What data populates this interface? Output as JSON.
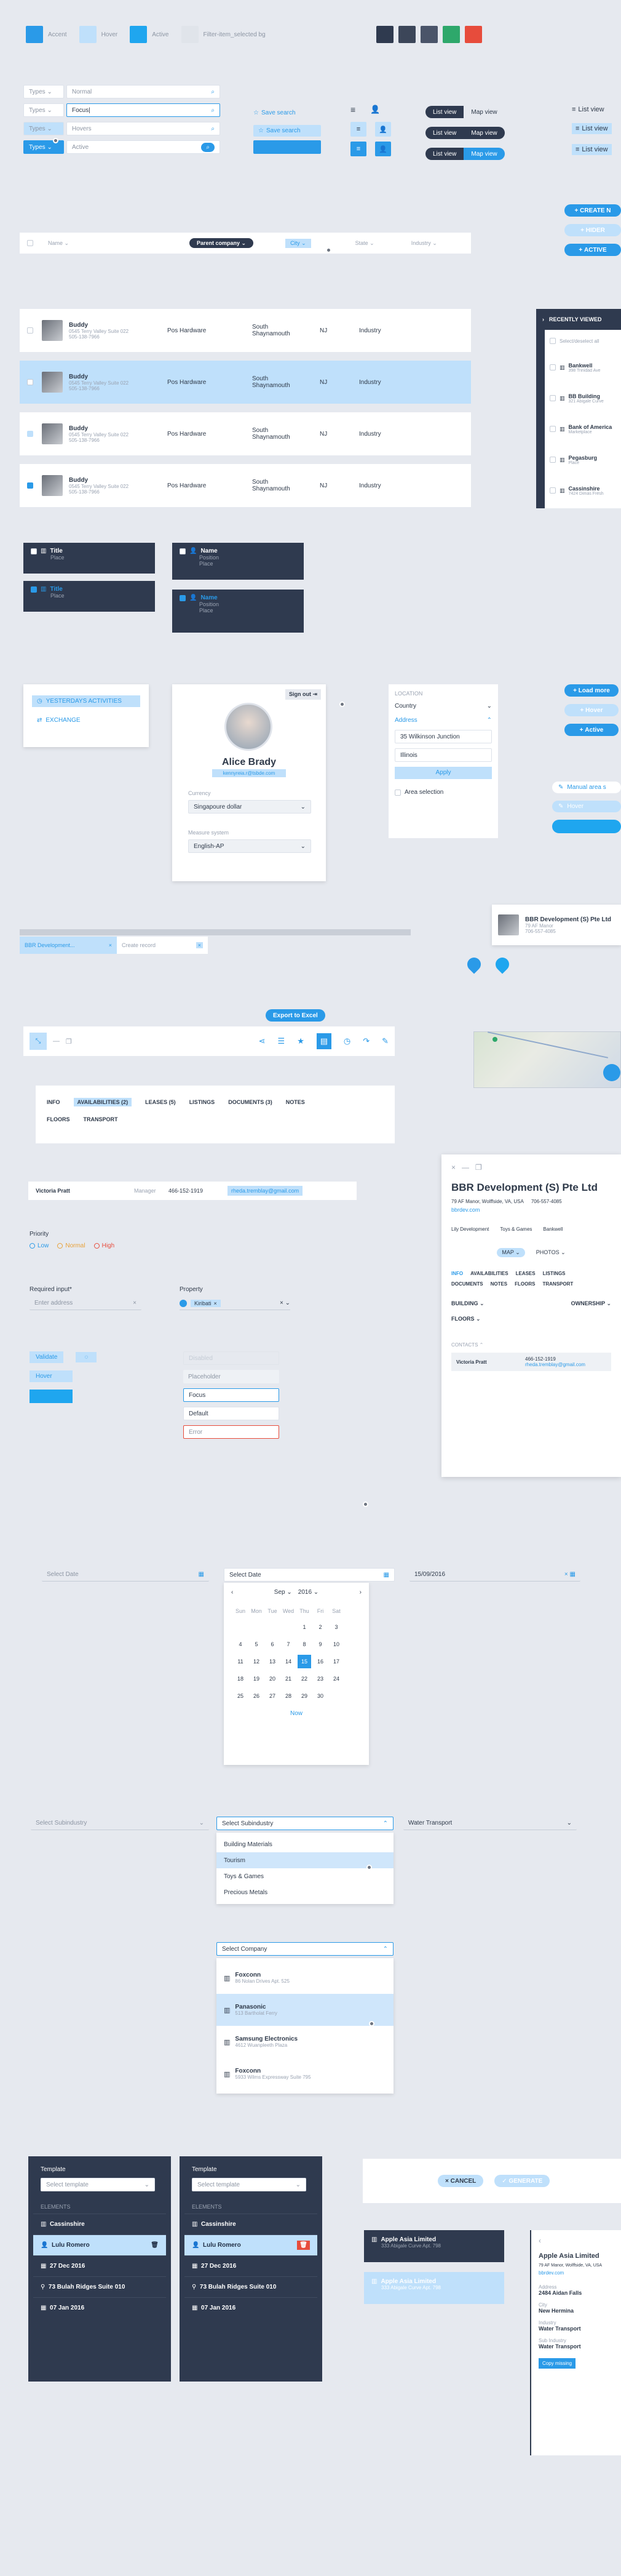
{
  "legend": [
    {
      "label": "Accent",
      "color": "#2a9ae8"
    },
    {
      "label": "Hover",
      "color": "#bfe0fb"
    },
    {
      "label": "Active",
      "color": "#1fa6ef"
    },
    {
      "label": "Filter-item_selected bg",
      "color": "#e0e4ea"
    }
  ],
  "palette": [
    "#2f3a4f",
    "#3c4659",
    "#4a5469",
    "#2ea86b",
    "#e74c3c"
  ],
  "filters": {
    "type_label": "Types",
    "rows": [
      {
        "value": "Normal"
      },
      {
        "value": "Focus|"
      },
      {
        "value": "Hovers"
      },
      {
        "value": "Active"
      }
    ]
  },
  "search": {
    "save_label": "Save search"
  },
  "viewtoggle": {
    "list": "List view",
    "map": "Map view"
  },
  "actions": {
    "create": "CREATE N",
    "hider": "HIDER",
    "active": "ACTIVE"
  },
  "table": {
    "headers": [
      "Name",
      "Parent company",
      "City",
      "State",
      "Industry"
    ],
    "rows": [
      {
        "name": "Buddy",
        "addr": "0545 Terry Valley Suite 022",
        "phone": "505-138-7966",
        "company": "Pos Hardware",
        "city1": "South",
        "city2": "Shaynamouth",
        "state": "NJ",
        "industry": "Industry"
      },
      {
        "name": "Buddy",
        "addr": "0545 Terry Valley Suite 022",
        "phone": "505-138-7966",
        "company": "Pos Hardware",
        "city1": "South",
        "city2": "Shaynamouth",
        "state": "NJ",
        "industry": "Industry"
      },
      {
        "name": "Buddy",
        "addr": "0545 Terry Valley Suite 022",
        "phone": "505-138-7966",
        "company": "Pos Hardware",
        "city1": "South",
        "city2": "Shaynamouth",
        "state": "NJ",
        "industry": "Industry"
      },
      {
        "name": "Buddy",
        "addr": "0545 Terry Valley Suite 022",
        "phone": "505-138-7966",
        "company": "Pos Hardware",
        "city1": "South",
        "city2": "Shaynamouth",
        "state": "NJ",
        "industry": "Industry"
      }
    ]
  },
  "recent": {
    "title": "RECENTLY VIEWED",
    "select_label": "Select/deselect all",
    "items": [
      {
        "name": "Bankwell",
        "sub": "398 Trinidad Ave"
      },
      {
        "name": "BB Building",
        "sub": "321 Abigale Curve"
      },
      {
        "name": "Bank of America",
        "sub": "Marketplace"
      },
      {
        "name": "Pegasburg",
        "sub": "Place"
      },
      {
        "name": "Cassinshire",
        "sub": "7424 Dimas Fresh"
      }
    ]
  },
  "cards": {
    "title": "Title",
    "place": "Place",
    "name": "Name",
    "position": "Position"
  },
  "history": {
    "yesterday": "YESTERDAYS ACTIVITIES",
    "exchange": "EXCHANGE"
  },
  "profile": {
    "signout": "Sign out",
    "name": "Alice Brady",
    "email": "kennyreia.r@tsbde.com",
    "currency_label": "Currency",
    "currency_value": "Singapoure dollar",
    "measure_label": "Measure system",
    "measure_value": "English-AP"
  },
  "location": {
    "title": "LOCATION",
    "country": "Country",
    "address": "Address",
    "address_value": "35 Wilkinson Junction",
    "state_value": "Illinois",
    "apply": "Apply",
    "area": "Area selection"
  },
  "loadmore": {
    "load": "Load more",
    "hover": "Hover",
    "active": "Active"
  },
  "manual": {
    "label": "Manual area s",
    "hover": "Hover"
  },
  "records": {
    "tab1": "BBR Development...",
    "tab2": "Create record"
  },
  "bbr_card": {
    "name": "BBR Development (S) Pte Ltd",
    "addr": "79 AF Manor",
    "phone": "706-557-4085"
  },
  "export": "Export to Excel",
  "tabs": {
    "row1": [
      "INFO",
      "AVAILABILITIES (2)",
      "LEASES (5)",
      "LISTINGS",
      "DOCUMENTS (3)",
      "NOTES"
    ],
    "row2": [
      "FLOORS",
      "TRANSPORT"
    ]
  },
  "contact": {
    "name": "Victoria Pratt",
    "role": "Manager",
    "phone": "466-152-1919",
    "email": "rheda.tremblay@gmail.com"
  },
  "priority": {
    "label": "Priority",
    "low": "Low",
    "normal": "Normal",
    "high": "High"
  },
  "required": {
    "label": "Required input*",
    "placeholder": "Enter address"
  },
  "property": {
    "label": "Property",
    "value": "Kiribati"
  },
  "buttons": {
    "validate": "Validate",
    "hover": "Hover"
  },
  "states": {
    "disabled": "Disabled",
    "placeholder": "Placeholder",
    "focus": "Focus",
    "default": "Default",
    "error": "Error"
  },
  "detail": {
    "name": "BBR Development (S) Pte Ltd",
    "addr": "79 AF Manor, Wolffside, VA, USA",
    "phone": "706-557-4085",
    "site": "bbrdev.com",
    "tags": [
      "Lily Development",
      "Toys & Games",
      "Bankwell"
    ],
    "map": "MAP",
    "photos": "PHOTOS",
    "tabs1": [
      "INFO",
      "AVAILABILITIES",
      "LEASES",
      "LISTINGS"
    ],
    "tabs2": [
      "DOCUMENTS",
      "NOTES",
      "FLOORS",
      "TRANSPORT"
    ],
    "building": "BUILDING",
    "ownership": "OWNERSHIP",
    "floors": "FLOORS",
    "contacts": "CONTACTS",
    "c_name": "Victoria Pratt",
    "c_phone": "466-152-1919",
    "c_email": "rheda.tremblay@gmail.com"
  },
  "dates": {
    "d1": "Select Date",
    "d2": "Select Date",
    "d3": "15/09/2016"
  },
  "calendar": {
    "month": "Sep",
    "year": "2016",
    "weekdays": [
      "Sun",
      "Mon",
      "Tue",
      "Wed",
      "Thu",
      "Fri",
      "Sat"
    ],
    "weeks": [
      [
        "",
        "",
        "",
        "",
        "1",
        "2",
        "3"
      ],
      [
        "4",
        "5",
        "6",
        "7",
        "8",
        "9",
        "10"
      ],
      [
        "11",
        "12",
        "13",
        "14",
        "15",
        "16",
        "17"
      ],
      [
        "18",
        "19",
        "20",
        "21",
        "22",
        "23",
        "24"
      ],
      [
        "25",
        "26",
        "27",
        "28",
        "29",
        "30",
        ""
      ]
    ],
    "selected": "15",
    "now": "Now"
  },
  "subindustry": {
    "placeholder": "Select Subindustry",
    "open": "Select Subindustry",
    "third": "Water Transport",
    "options": [
      "Building Materials",
      "Tourism",
      "Toys & Games",
      "Precious Metals"
    ]
  },
  "company": {
    "placeholder": "Select Company",
    "options": [
      {
        "name": "Foxconn",
        "sub": "86 Nolan Drives Apt. 525"
      },
      {
        "name": "Panasonic",
        "sub": "513 Bartholat Ferry"
      },
      {
        "name": "Samsung Electronics",
        "sub": "4612 Wuanpleeth Plaza"
      },
      {
        "name": "Foxconn",
        "sub": "5933 Wilms Expressway Suite 795"
      }
    ]
  },
  "template": {
    "label": "Template",
    "placeholder": "Select template",
    "elements": "ELEMENTS",
    "items": [
      "Cassinshire",
      "Lulu Romero",
      "27 Dec 2016",
      "73 Bulah Ridges Suite 010",
      "07 Jan 2016"
    ]
  },
  "generate": {
    "cancel": "CANCEL",
    "generate": "GENERATE"
  },
  "apple": {
    "name": "Apple Asia Limited",
    "sub": "333 Abigale Curve Apt. 798"
  },
  "apple_detail": {
    "name": "Apple Asia Limited",
    "addr": "79 AF Manor, Wolffside, VA, USA",
    "site": "bbrdev.com",
    "address_label": "Address",
    "address_value": "2484 Aidan Falls",
    "city_label": "City",
    "city_value": "New Hermina",
    "industry_label": "Industry",
    "industry_value": "Water Transport",
    "sub_label": "Sub Industry",
    "sub_value": "Water Transport",
    "copy": "Copy missing"
  }
}
